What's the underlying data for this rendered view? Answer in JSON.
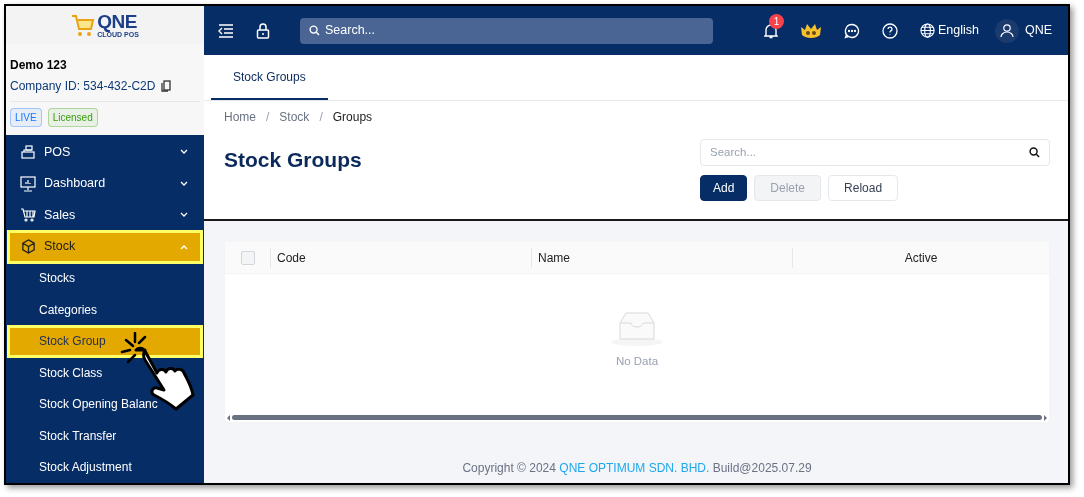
{
  "logo": {
    "title": "QNE",
    "subtitle": "CLOUD POS"
  },
  "header": {
    "search_placeholder": "Search...",
    "notification_count": "1",
    "language": "English",
    "user": "QNE"
  },
  "company": {
    "name": "Demo 123",
    "id": "Company ID: 534-432-C2D",
    "badges": [
      {
        "label": "LIVE",
        "color": "#1677ff"
      },
      {
        "label": "Licensed",
        "color": "#389e0d"
      }
    ]
  },
  "sidebar": {
    "items": [
      {
        "label": "POS",
        "expanded": false,
        "selected": false
      },
      {
        "label": "Dashboard",
        "expanded": false,
        "selected": false
      },
      {
        "label": "Sales",
        "expanded": false,
        "selected": false
      },
      {
        "label": "Stock",
        "expanded": true,
        "selected": true,
        "children": [
          {
            "label": "Stocks",
            "selected": false
          },
          {
            "label": "Categories",
            "selected": false
          },
          {
            "label": "Stock Group",
            "selected": true
          },
          {
            "label": "Stock Class",
            "selected": false
          },
          {
            "label": "Stock Opening Balanc",
            "selected": false
          },
          {
            "label": "Stock Transfer",
            "selected": false
          },
          {
            "label": "Stock Adjustment",
            "selected": false
          }
        ]
      }
    ]
  },
  "tabs": [
    {
      "label": "Stock Groups",
      "selected": true
    }
  ],
  "breadcrumb": {
    "items": [
      "Home",
      "Stock",
      "Groups"
    ],
    "separator": "/"
  },
  "page_title": "Stock Groups",
  "search": {
    "placeholder": "Search..."
  },
  "buttons": [
    {
      "label": "Add",
      "kind": "primary",
      "disabled": false
    },
    {
      "label": "Delete",
      "kind": "default",
      "disabled": true
    },
    {
      "label": "Reload",
      "kind": "default",
      "disabled": false
    }
  ],
  "table": {
    "columns": [
      "Code",
      "Name",
      "Active"
    ],
    "select_all_checked": false,
    "empty_text": "No Data"
  },
  "footer": {
    "text_before": "Copyright © 2024",
    "link": "QNE OPTIMUM SDN. BHD.",
    "text_after": "Build@2025.07.29"
  }
}
